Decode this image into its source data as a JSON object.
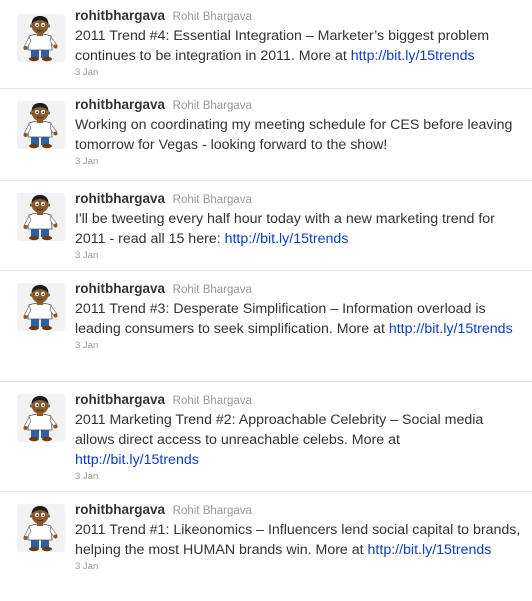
{
  "tweets": [
    {
      "screen_name": "rohitbhargava",
      "full_name": "Rohit Bhargava",
      "text": "2011 Trend #4: Essential Integration – Marketer’s biggest problem continues to be integration in 2011. More at ",
      "link": "http://bit.ly/15trends",
      "timestamp": "3 Jan"
    },
    {
      "screen_name": "rohitbhargava",
      "full_name": "Rohit Bhargava",
      "text": "Working on coordinating my meeting schedule for CES before leaving tomorrow for Vegas - looking forward to the show!",
      "link": "",
      "timestamp": "3 Jan"
    },
    {
      "screen_name": "rohitbhargava",
      "full_name": "Rohit Bhargava",
      "text": "I'll be tweeting every half hour today with a new marketing trend for 2011 - read all 15 here: ",
      "link": "http://bit.ly/15trends",
      "timestamp": "3 Jan"
    },
    {
      "screen_name": "rohitbhargava",
      "full_name": "Rohit Bhargava",
      "text": "2011 Trend #3: Desperate Simplification – Information overload is leading consumers to seek simplification. More at ",
      "link": "http://bit.ly/15trends",
      "timestamp": "3 Jan"
    },
    {
      "screen_name": "rohitbhargava",
      "full_name": "Rohit Bhargava",
      "text": "2011 Marketing Trend #2: Approachable Celebrity – Social media allows direct access to unreachable celebs. More at ",
      "link": "http://bit.ly/15trends",
      "timestamp": "3 Jan"
    },
    {
      "screen_name": "rohitbhargava",
      "full_name": "Rohit Bhargava",
      "text": "2011 Trend #1: Likeonomics – Influencers lend social capital to brands, helping the most HUMAN brands win. More at ",
      "link": "http://bit.ly/15trends",
      "timestamp": "3 Jan"
    }
  ]
}
